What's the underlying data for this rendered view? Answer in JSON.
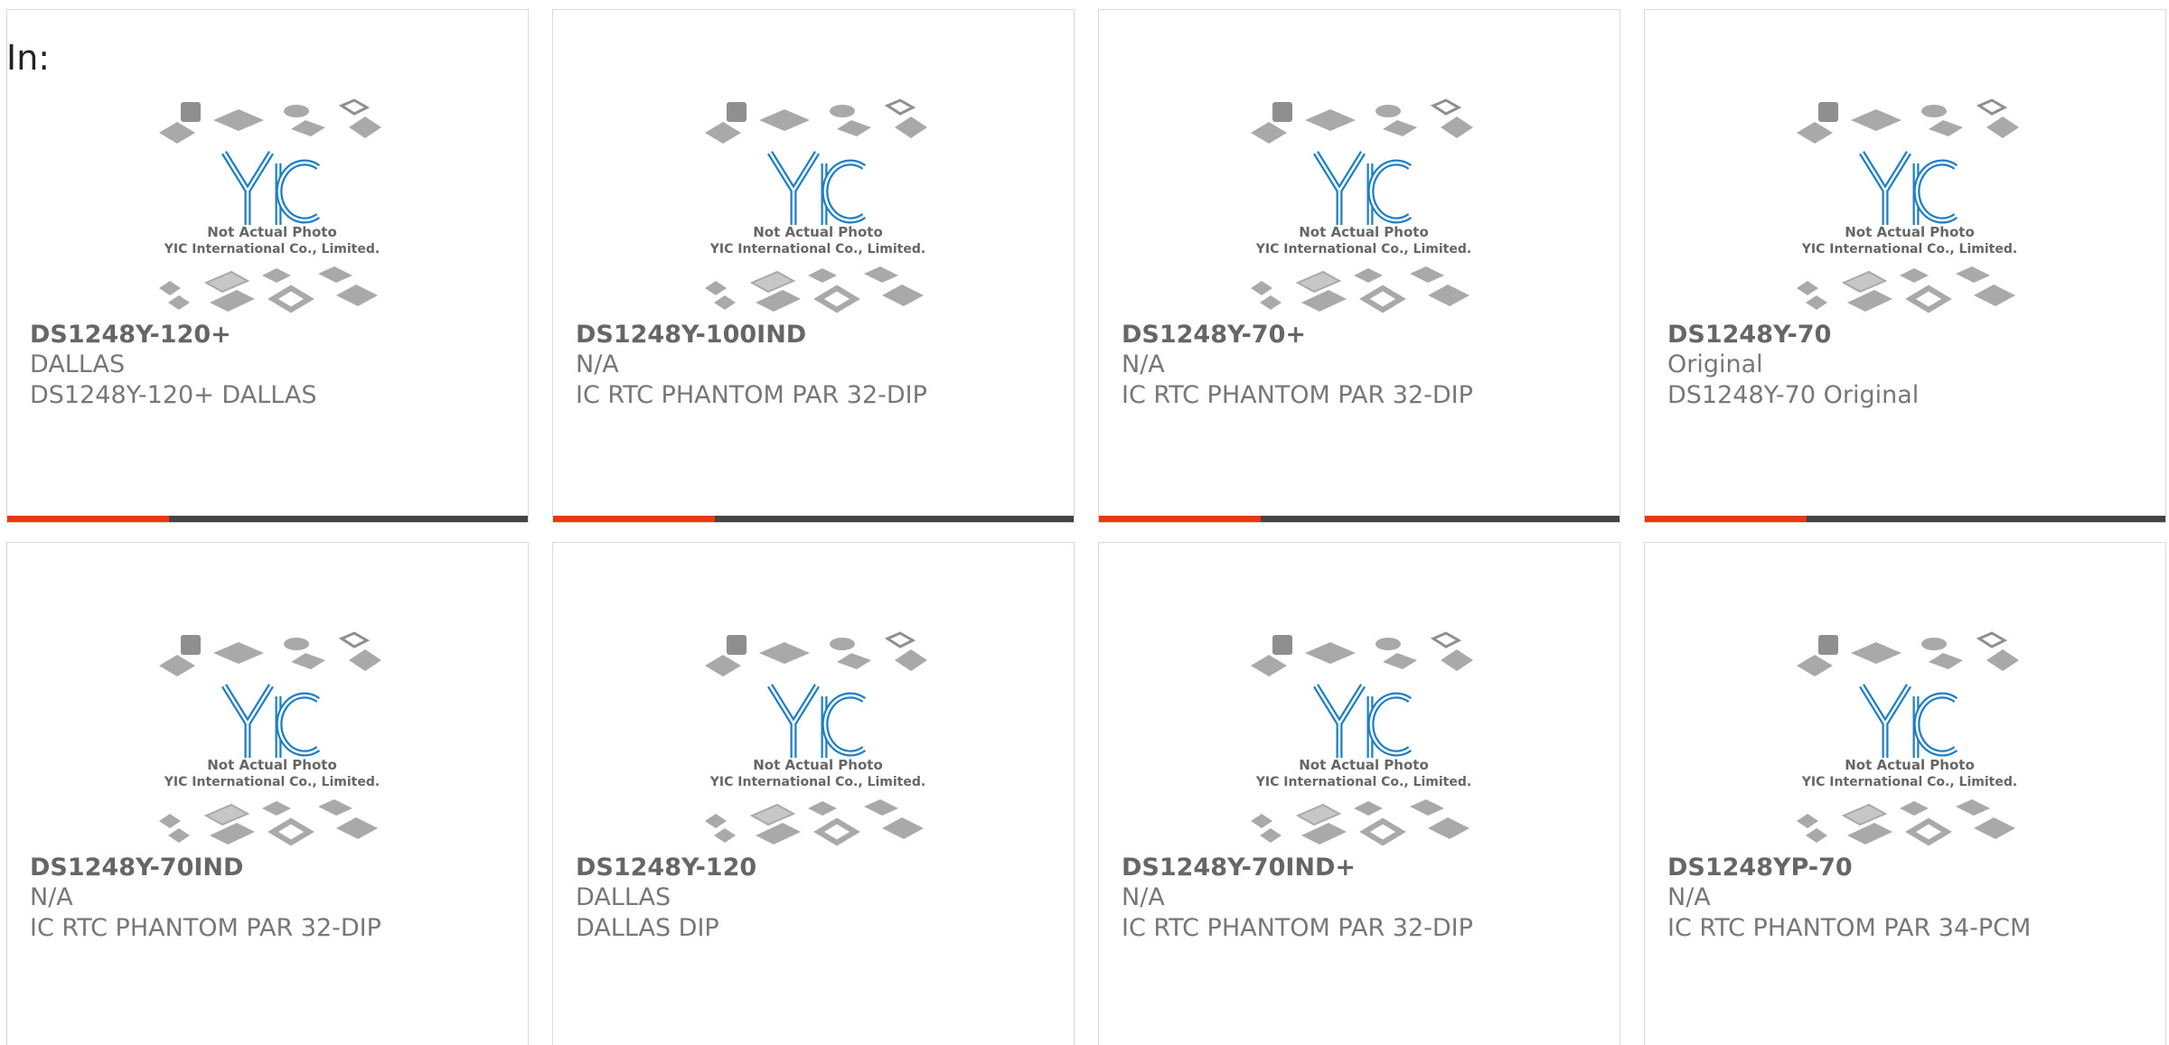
{
  "header": {
    "in_label": "In:"
  },
  "photo_caption": {
    "logo_text": "YIC",
    "line1": "Not Actual Photo",
    "line2": "YIC International Co., Limited."
  },
  "colors": {
    "accent": "#e8380d",
    "bar_track": "#444444",
    "logo_blue": "#1f7fc4",
    "text_gray": "#777777"
  },
  "products": [
    {
      "name": "DS1248Y-120+",
      "maker": "DALLAS",
      "desc": "DS1248Y-120+ DALLAS",
      "progress_fraction": 0.31
    },
    {
      "name": "DS1248Y-100IND",
      "maker": "N/A",
      "desc": "IC RTC PHANTOM PAR 32-DIP",
      "progress_fraction": 0.31
    },
    {
      "name": "DS1248Y-70+",
      "maker": "N/A",
      "desc": "IC RTC PHANTOM PAR 32-DIP",
      "progress_fraction": 0.31
    },
    {
      "name": "DS1248Y-70",
      "maker": "Original",
      "desc": "DS1248Y-70 Original",
      "progress_fraction": 0.31
    },
    {
      "name": "DS1248Y-70IND",
      "maker": "N/A",
      "desc": "IC RTC PHANTOM PAR 32-DIP"
    },
    {
      "name": "DS1248Y-120",
      "maker": "DALLAS",
      "desc": "DALLAS DIP"
    },
    {
      "name": "DS1248Y-70IND+",
      "maker": "N/A",
      "desc": "IC RTC PHANTOM PAR 32-DIP"
    },
    {
      "name": "DS1248YP-70",
      "maker": "N/A",
      "desc": "IC RTC PHANTOM PAR 34-PCM"
    }
  ]
}
